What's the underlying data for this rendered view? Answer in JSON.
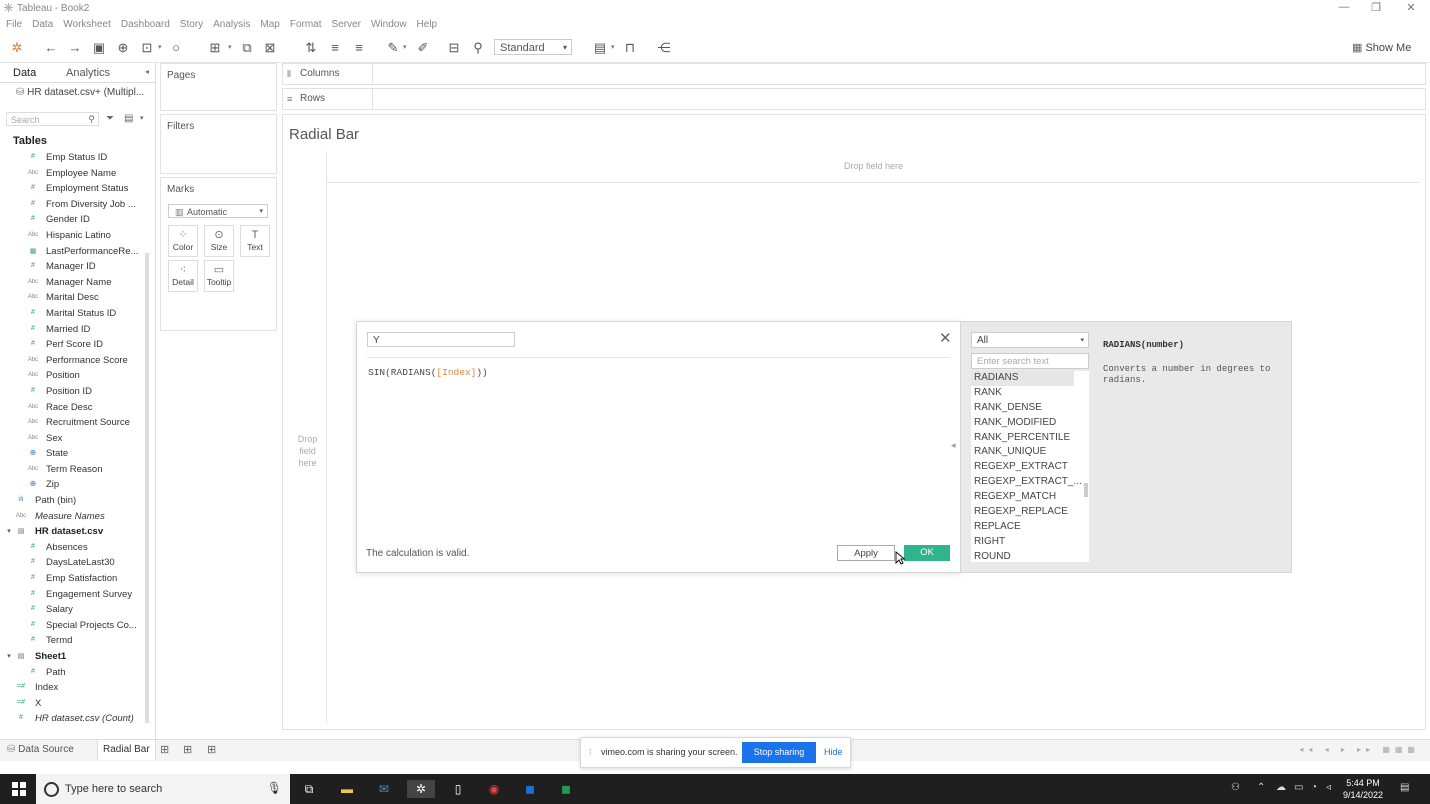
{
  "window": {
    "title": "Tableau - Book2",
    "controls": [
      "—",
      "❐",
      "✕"
    ]
  },
  "menu": [
    "File",
    "Data",
    "Worksheet",
    "Dashboard",
    "Story",
    "Analysis",
    "Map",
    "Format",
    "Server",
    "Window",
    "Help"
  ],
  "toolbar": {
    "fit_value": "Standard",
    "show_me": "Show Me"
  },
  "left_pane": {
    "tab_data": "Data",
    "tab_analytics": "Analytics",
    "datasource": "HR dataset.csv+ (Multipl...",
    "search_placeholder": "Search",
    "tables_header": "Tables",
    "fields": [
      {
        "type": "num",
        "name": "Emp Status ID"
      },
      {
        "type": "abc",
        "name": "Employee Name"
      },
      {
        "type": "num",
        "name": "Employment Status"
      },
      {
        "type": "num",
        "name": "From Diversity Job ..."
      },
      {
        "type": "num",
        "name": "Gender ID"
      },
      {
        "type": "abc",
        "name": "Hispanic Latino"
      },
      {
        "type": "date",
        "name": "LastPerformanceRe..."
      },
      {
        "type": "num",
        "name": "Manager ID"
      },
      {
        "type": "abc",
        "name": "Manager Name"
      },
      {
        "type": "abc",
        "name": "Marital Desc"
      },
      {
        "type": "num",
        "name": "Marital Status ID"
      },
      {
        "type": "num",
        "name": "Married ID"
      },
      {
        "type": "num",
        "name": "Perf Score ID"
      },
      {
        "type": "abc",
        "name": "Performance Score"
      },
      {
        "type": "abc",
        "name": "Position"
      },
      {
        "type": "num",
        "name": "Position ID"
      },
      {
        "type": "abc",
        "name": "Race Desc"
      },
      {
        "type": "abc",
        "name": "Recruitment Source"
      },
      {
        "type": "abc",
        "name": "Sex"
      },
      {
        "type": "geo",
        "name": "State"
      },
      {
        "type": "abc",
        "name": "Term Reason"
      },
      {
        "type": "geo",
        "name": "Zip"
      },
      {
        "type": "bin",
        "name": "Path (bin)",
        "indent": 1
      },
      {
        "type": "abc",
        "name": "Measure Names",
        "indent": 1,
        "italic": true
      },
      {
        "type": "table",
        "name": "HR dataset.csv",
        "header": true
      },
      {
        "type": "num",
        "name": "Absences"
      },
      {
        "type": "num",
        "name": "DaysLateLast30"
      },
      {
        "type": "num",
        "name": "Emp Satisfaction"
      },
      {
        "type": "num",
        "name": "Engagement Survey"
      },
      {
        "type": "num",
        "name": "Salary"
      },
      {
        "type": "num",
        "name": "Special Projects Co..."
      },
      {
        "type": "num",
        "name": "Termd"
      },
      {
        "type": "table",
        "name": "Sheet1",
        "header": true
      },
      {
        "type": "num",
        "name": "Path"
      },
      {
        "type": "calc",
        "name": "Index",
        "indent": 1
      },
      {
        "type": "calc",
        "name": "X",
        "indent": 1
      },
      {
        "type": "num",
        "name": "HR dataset.csv (Count)",
        "indent": 1,
        "italic": true
      }
    ]
  },
  "cards": {
    "pages": "Pages",
    "filters": "Filters",
    "marks": "Marks",
    "mark_type": "Automatic",
    "mark_buttons": [
      {
        "label": "Color",
        "icon": "color-icon"
      },
      {
        "label": "Size",
        "icon": "size-icon"
      },
      {
        "label": "Text",
        "icon": "text-icon"
      },
      {
        "label": "Detail",
        "icon": "detail-icon"
      },
      {
        "label": "Tooltip",
        "icon": "tooltip-icon"
      }
    ]
  },
  "shelves": {
    "columns": "Columns",
    "rows": "Rows"
  },
  "view": {
    "title": "Radial Bar",
    "drop_field_top": "Drop field here",
    "drop_field_left": "Drop field here"
  },
  "calc_dialog": {
    "name": "Y",
    "formula_fn": "SIN(RADIANS(",
    "formula_field": "[Index]",
    "formula_close": "))",
    "status": "The calculation is valid.",
    "apply": "Apply",
    "ok": "OK"
  },
  "functions": {
    "category": "All",
    "search_placeholder": "Enter search text",
    "list": [
      "RADIANS",
      "RANK",
      "RANK_DENSE",
      "RANK_MODIFIED",
      "RANK_PERCENTILE",
      "RANK_UNIQUE",
      "REGEXP_EXTRACT",
      "REGEXP_EXTRACT_...",
      "REGEXP_MATCH",
      "REGEXP_REPLACE",
      "REPLACE",
      "RIGHT",
      "ROUND"
    ],
    "selected": "RADIANS",
    "signature": "RADIANS(number)",
    "description": "Converts a number in degrees to radians."
  },
  "sheet_tabs": {
    "data_source": "Data Source",
    "active": "Radial Bar"
  },
  "screen_share": {
    "message": "vimeo.com is sharing your screen.",
    "stop": "Stop sharing",
    "hide": "Hide"
  },
  "taskbar": {
    "search_placeholder": "Type here to search",
    "time": "5:44 PM",
    "date": "9/14/2022"
  },
  "colors": {
    "ok_green": "#2fb58e",
    "share_blue": "#1a73e8",
    "field_teal": "#3a9d8f",
    "formula_field_orange": "#e08a3a"
  }
}
